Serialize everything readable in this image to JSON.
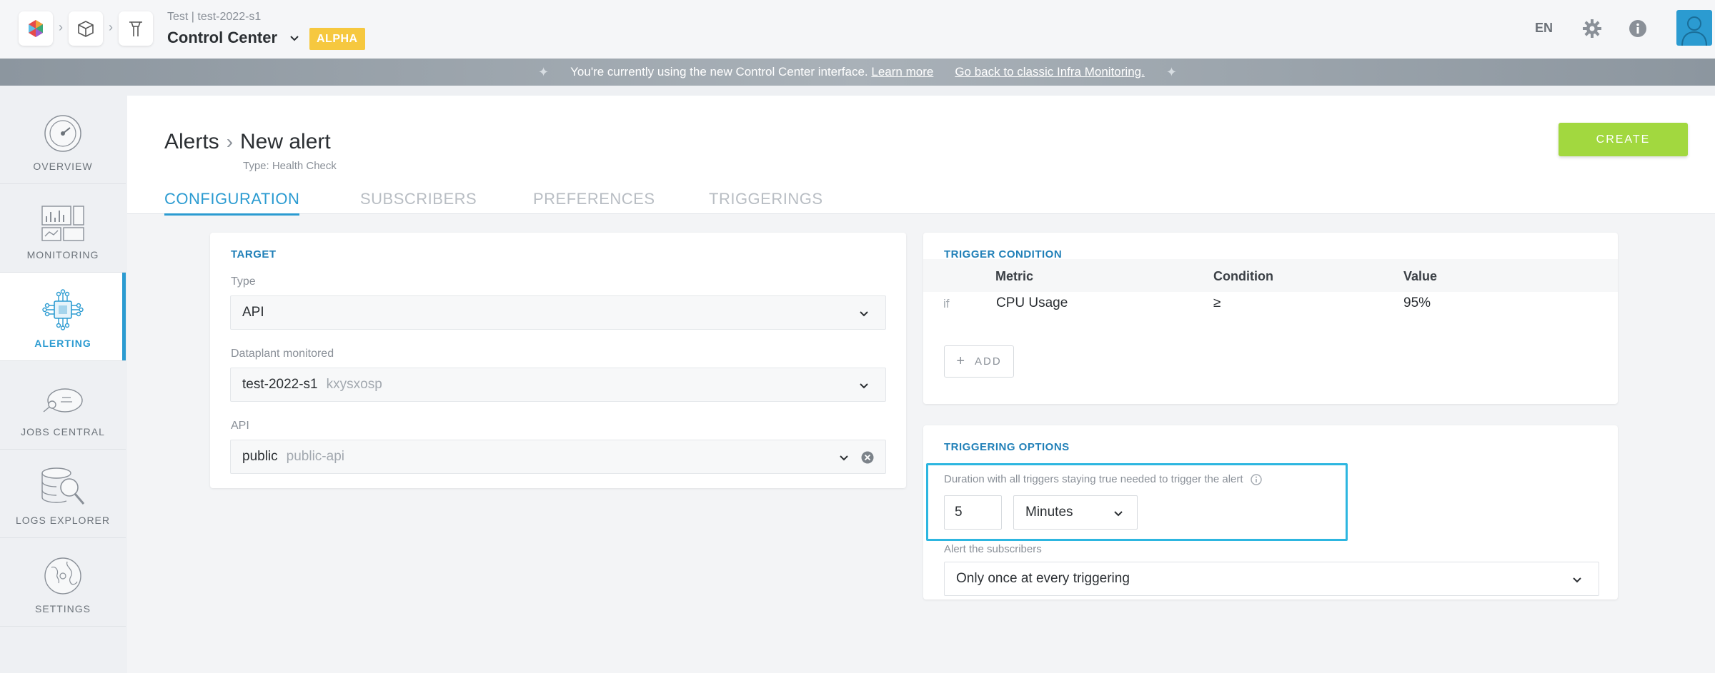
{
  "topbar": {
    "context_sub": "Test | test-2022-s1",
    "context_main": "Control Center",
    "badge": "ALPHA",
    "lang": "EN"
  },
  "banner": {
    "message": "You're currently using the new Control Center interface.",
    "learn_more": "Learn more",
    "classic_link": "Go back to classic Infra Monitoring."
  },
  "sidebar": {
    "items": [
      {
        "label": "OVERVIEW",
        "icon": "gauge-icon"
      },
      {
        "label": "MONITORING",
        "icon": "dashboard-icon"
      },
      {
        "label": "ALERTING",
        "icon": "circuit-icon"
      },
      {
        "label": "JOBS CENTRAL",
        "icon": "satellite-icon"
      },
      {
        "label": "LOGS EXPLORER",
        "icon": "database-search-icon"
      },
      {
        "label": "SETTINGS",
        "icon": "globe-icon"
      }
    ],
    "active_index": 2
  },
  "header": {
    "breadcrumb_root": "Alerts",
    "breadcrumb_current": "New alert",
    "subtitle": "Type: Health Check",
    "create_label": "CREATE"
  },
  "tabs": [
    {
      "label": "CONFIGURATION"
    },
    {
      "label": "SUBSCRIBERS"
    },
    {
      "label": "PREFERENCES"
    },
    {
      "label": "TRIGGERINGS"
    }
  ],
  "target": {
    "title": "TARGET",
    "type_label": "Type",
    "type_value": "API",
    "dataplant_label": "Dataplant monitored",
    "dataplant_value": "test-2022-s1",
    "dataplant_id": "kxysxosp",
    "api_label": "API",
    "api_value": "public",
    "api_id": "public-api"
  },
  "trigger_condition": {
    "title": "TRIGGER CONDITION",
    "headers": [
      "Metric",
      "Condition",
      "Value"
    ],
    "rows": [
      {
        "prefix": "if",
        "metric": "CPU Usage",
        "condition": "≥",
        "value": "95%"
      }
    ],
    "add_label": "ADD"
  },
  "triggering_options": {
    "title": "TRIGGERING OPTIONS",
    "duration_label": "Duration with all triggers staying true needed to trigger the alert",
    "duration_value": "5",
    "duration_unit": "Minutes",
    "subscribers_label": "Alert the subscribers",
    "subscribers_value": "Only once at every triggering"
  },
  "colors": {
    "accent": "#2b9bd1",
    "create": "#a2d83f",
    "badge": "#f6c83f",
    "highlight": "#2db6e0"
  }
}
